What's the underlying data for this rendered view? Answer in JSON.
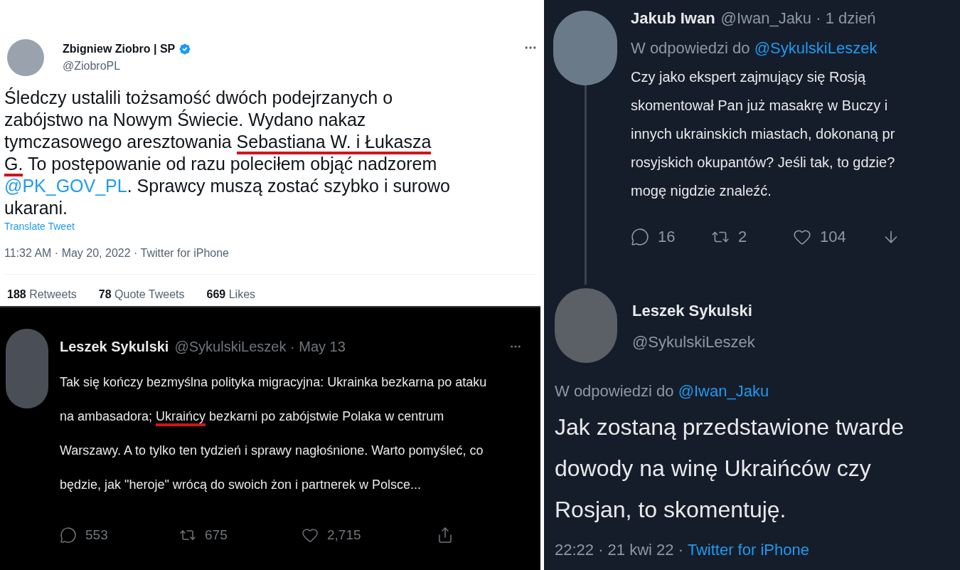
{
  "tweet_main": {
    "author": "Zbigniew Ziobro | SP",
    "verified": true,
    "handle": "@ZiobroPL",
    "body_lines": [
      [
        {
          "text": "Śledczy ustalili tożsamość dwóch podejrzanych o",
          "kind": "plain",
          "underlined": false
        }
      ],
      [
        {
          "text": "zabójstwo na Nowym Świecie. Wydano nakaz",
          "kind": "plain",
          "underlined": false
        }
      ],
      [
        {
          "text": "tymczasowego aresztowania ",
          "kind": "plain",
          "underlined": false
        },
        {
          "text": "Sebastiana W. i Łukasza",
          "kind": "plain",
          "underlined": true
        }
      ],
      [
        {
          "text": "G.",
          "kind": "plain",
          "underlined": true
        },
        {
          "text": " To postępowanie od razu poleciłem objąć nadzorem",
          "kind": "plain",
          "underlined": false
        }
      ],
      [
        {
          "text": "@PK_GOV_PL",
          "kind": "mention",
          "underlined": false
        },
        {
          "text": ". Sprawcy muszą zostać szybko i surowo",
          "kind": "plain",
          "underlined": false
        }
      ],
      [
        {
          "text": "ukarani.",
          "kind": "plain",
          "underlined": false
        }
      ]
    ],
    "translate": "Translate Tweet",
    "meta": "11:32 AM · May 20, 2022 · Twitter for iPhone",
    "stats": [
      {
        "count": "188",
        "label": "Retweets"
      },
      {
        "count": "78",
        "label": "Quote Tweets"
      },
      {
        "count": "669",
        "label": "Likes"
      }
    ]
  },
  "tweet_dark": {
    "author": "Leszek Sykulski",
    "handle": "@SykulskiLeszek · May 13",
    "body_lines": [
      [
        {
          "text": "Tak się kończy bezmyślna polityka migracyjna: Ukrainka bezkarna po ataku",
          "kind": "plain",
          "underlined": false
        }
      ],
      [
        {
          "text": "na ambasadora; ",
          "kind": "plain",
          "underlined": false
        },
        {
          "text": "Ukraińcy",
          "kind": "plain",
          "underlined": true
        },
        {
          "text": " bezkarni po zabójstwie Polaka w centrum",
          "kind": "plain",
          "underlined": false
        }
      ],
      [
        {
          "text": "Warszawy. A to tylko ten tydzień i sprawy nagłośnione. Warto pomyśleć, co",
          "kind": "plain",
          "underlined": false
        }
      ],
      [
        {
          "text": "będzie, jak \"heroje\" wrócą do swoich żon i partnerek w Polsce...",
          "kind": "plain",
          "underlined": false
        }
      ]
    ],
    "actions": [
      {
        "kind": "reply",
        "count": "553"
      },
      {
        "kind": "retweet",
        "count": "675"
      },
      {
        "kind": "like",
        "count": "2,715"
      },
      {
        "kind": "share"
      }
    ]
  },
  "thread": {
    "reply": {
      "author": "Jakub Iwan",
      "handle": "@Iwan_Jaku · 1 dzień",
      "reply_to_label": "W odpowiedzi do",
      "reply_to": "@SykulskiLeszek",
      "body_lines": [
        "Czy jako ekspert zajmujący się Rosją",
        "skomentował Pan już masakrę w Buczy i",
        "innych ukrainskich miastach, dokonaną pr",
        "rosyjskich okupantów? Jeśli tak, to gdzie?",
        "mogę nigdzie znaleźć."
      ],
      "actions": [
        {
          "kind": "reply",
          "count": "16"
        },
        {
          "kind": "retweet",
          "count": "2"
        },
        {
          "kind": "like",
          "count": "104"
        },
        {
          "kind": "download"
        }
      ]
    },
    "answer": {
      "author": "Leszek Sykulski",
      "handle": "@SykulskiLeszek",
      "reply_to_label": "W odpowiedzi do",
      "reply_to": "@Iwan_Jaku",
      "body_lines": [
        "Jak zostaną przedstawione twarde",
        "dowody na winę Ukraińców czy",
        "Rosjan, to skomentuję."
      ],
      "time": "22:22 · 21 kwi 22 ·",
      "source": "Twitter for iPhone"
    }
  }
}
